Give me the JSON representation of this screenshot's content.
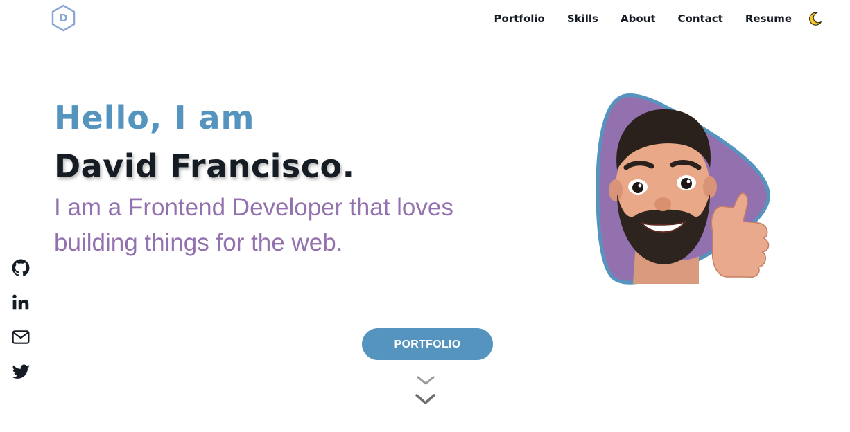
{
  "header": {
    "logo_letter": "D",
    "logo_icon": "hexagon-logo",
    "nav": [
      {
        "label": "Portfolio"
      },
      {
        "label": "Skills"
      },
      {
        "label": "About"
      },
      {
        "label": "Contact"
      },
      {
        "label": "Resume"
      }
    ],
    "theme_toggle_icon": "moon-icon"
  },
  "hero": {
    "greeting": "Hello, I am",
    "name": "David Francisco",
    "name_suffix": ".",
    "tagline": "I am a Frontend Developer that loves building things for the web.",
    "avatar_icon": "memoji-thumbs-up-avatar",
    "cta_label": "PORTFOLIO",
    "scroll_icon": "double-chevron-down-icon"
  },
  "social": [
    {
      "name": "github",
      "icon": "github-icon"
    },
    {
      "name": "linkedin",
      "icon": "linkedin-icon"
    },
    {
      "name": "email",
      "icon": "mail-icon"
    },
    {
      "name": "twitter",
      "icon": "twitter-icon"
    }
  ],
  "colors": {
    "accent_blue": "#5694c0",
    "accent_purple": "#9371ae",
    "text_dark": "#161c24",
    "logo_stroke": "#8aa7d3",
    "background": "#ffffff"
  }
}
